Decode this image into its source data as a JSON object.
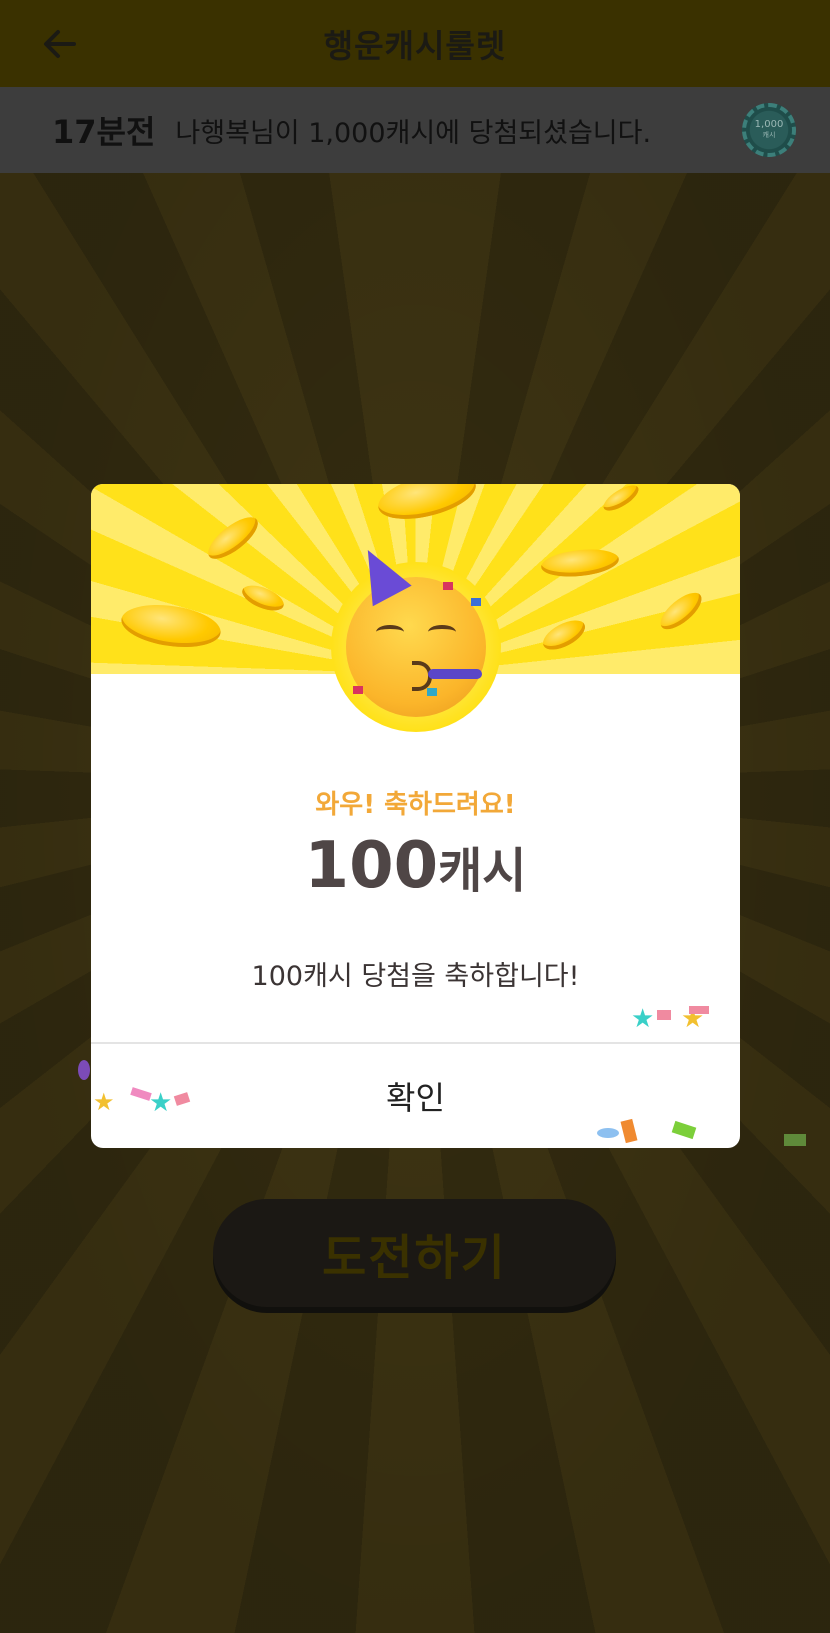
{
  "header": {
    "title": "행운캐시룰렛",
    "back_icon": "arrow-left-icon"
  },
  "ticker": {
    "time": "17분전",
    "text": "나행복님이 1,000캐시에 당첨되셨습니다.",
    "badge_value": "1,000",
    "badge_unit": "캐시"
  },
  "modal": {
    "subtitle": "와우! 축하드려요!",
    "amount_number": "100",
    "amount_unit": "캐시",
    "message": "100캐시 당첨을 축하합니다!",
    "confirm_label": "확인"
  },
  "challenge": {
    "label": "도전하기"
  },
  "colors": {
    "accent_yellow": "#ffe11a",
    "subtitle_orange": "#f2a838",
    "amount_text": "#4f4646"
  }
}
